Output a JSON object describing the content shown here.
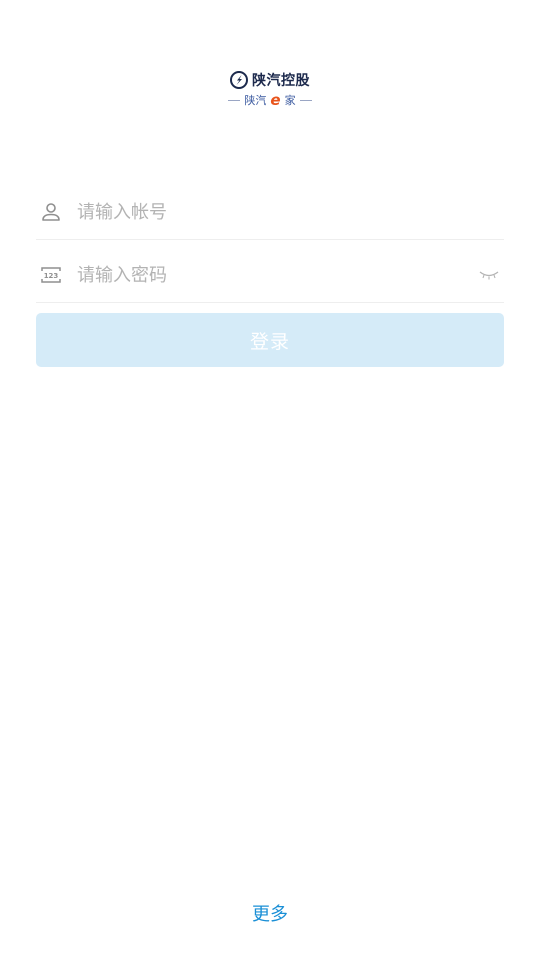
{
  "logo": {
    "brand": "陕汽控股",
    "sub_prefix": "陕汽",
    "sub_e": "e",
    "sub_suffix": "家"
  },
  "login_form": {
    "account_placeholder": "请输入帐号",
    "password_placeholder": "请输入密码",
    "login_button": "登录"
  },
  "footer": {
    "more_link": "更多"
  },
  "colors": {
    "accent": "#1a8fd6",
    "button_disabled": "#d5ebf8",
    "logo_orange": "#e8541c",
    "logo_navy": "#1d2a4d"
  },
  "icons": {
    "account": "user-icon",
    "password": "keypad-123-icon",
    "visibility": "eye-closed-icon"
  }
}
